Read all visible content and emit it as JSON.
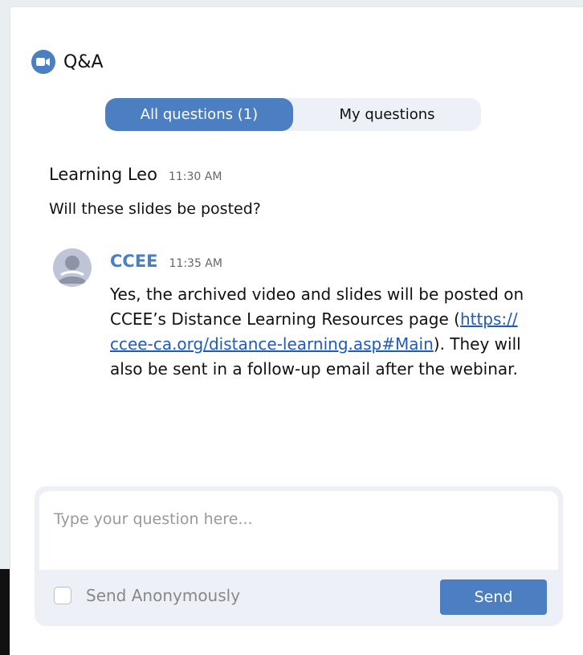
{
  "header": {
    "title": "Q&A",
    "icon": "video-camera-icon"
  },
  "tabs": [
    {
      "label": "All questions (1)",
      "active": true
    },
    {
      "label": "My questions",
      "active": false
    }
  ],
  "question": {
    "asker": "Learning Leo",
    "time": "11:30 AM",
    "text": "Will these slides be posted?"
  },
  "answer": {
    "answerer": "CCEE",
    "time": "11:35 AM",
    "text_before": "Yes, the archived video and slides will be posted on CCEE’s Distance Learning Resources page (",
    "link": "https:// ccee-ca.org/distance-learning.asp#Main",
    "text_after": "). They will also be sent in a follow-up email after the webinar."
  },
  "composer": {
    "placeholder": "Type your question here...",
    "anonymous_label": "Send Anonymously",
    "send_label": "Send"
  },
  "colors": {
    "accent": "#4b7fc2",
    "link": "#1f5bbf",
    "tabs_bg": "#eef0f8"
  }
}
